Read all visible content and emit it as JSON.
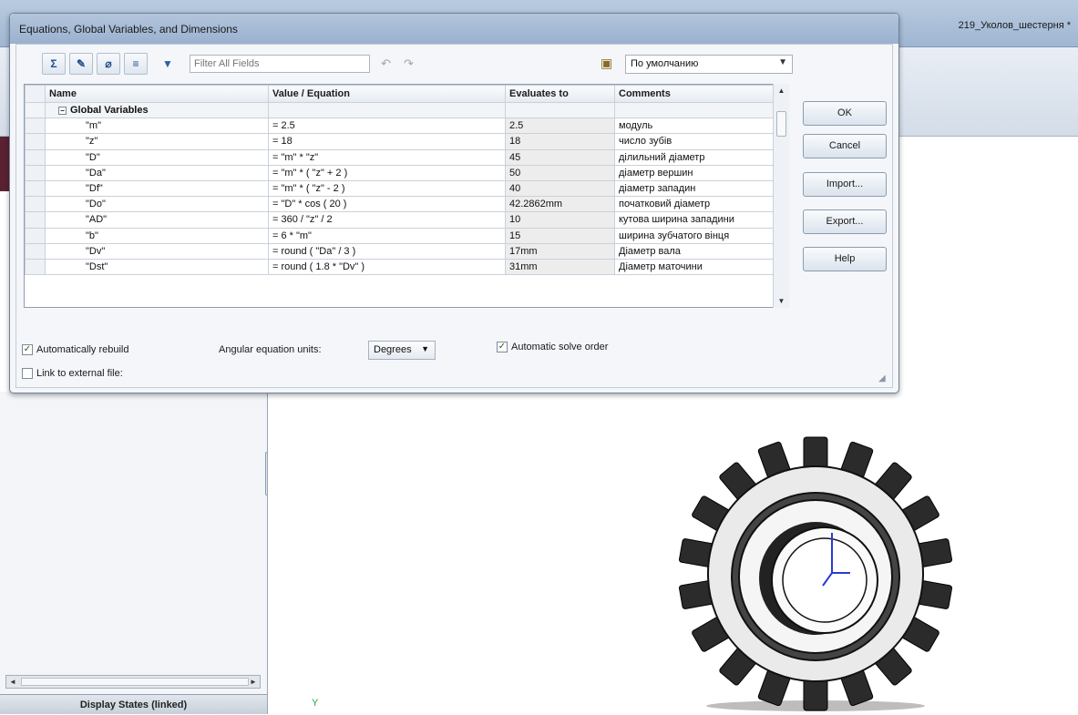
{
  "app": {
    "document_title": "219_Уколов_шестерня *",
    "display_states_label": "Display States (linked)",
    "axis_y_label": "Y"
  },
  "dialog": {
    "title": "Equations, Global Variables, and Dimensions",
    "filter_placeholder": "Filter All Fields",
    "configuration": "По умолчанию",
    "columns": [
      "Name",
      "Value / Equation",
      "Evaluates to",
      "Comments"
    ],
    "group_label": "Global Variables",
    "rows": [
      {
        "name": "\"m\"",
        "value": "= 2.5",
        "evaluates": "2.5",
        "comment": "модуль"
      },
      {
        "name": "\"z\"",
        "value": "= 18",
        "evaluates": "18",
        "comment": "число зубів"
      },
      {
        "name": "\"D\"",
        "value": "= \"m\" * \"z\"",
        "evaluates": "45",
        "comment": "ділильний діаметр"
      },
      {
        "name": "\"Da\"",
        "value": "= \"m\" * ( \"z\" + 2 )",
        "evaluates": "50",
        "comment": "діаметр вершин"
      },
      {
        "name": "\"Df\"",
        "value": "= \"m\" * ( \"z\" - 2 )",
        "evaluates": "40",
        "comment": "діаметр западин"
      },
      {
        "name": "\"Do\"",
        "value": "= \"D\" * cos ( 20 )",
        "evaluates": "42.2862mm",
        "comment": "початковий діаметр"
      },
      {
        "name": "\"AD\"",
        "value": "= 360 / \"z\" / 2",
        "evaluates": "10",
        "comment": "кутова ширина западини"
      },
      {
        "name": "\"b\"",
        "value": "= 6 * \"m\"",
        "evaluates": "15",
        "comment": "ширина зубчатого вінця"
      },
      {
        "name": "\"Dv\"",
        "value": "= round ( \"Da\" / 3 )",
        "evaluates": "17mm",
        "comment": "Діаметр вала"
      },
      {
        "name": "\"Dst\"",
        "value": "= round ( 1.8 * \"Dv\" )",
        "evaluates": "31mm",
        "comment": "Діаметр маточини"
      }
    ],
    "buttons": {
      "ok": "OK",
      "cancel": "Cancel",
      "import": "Import...",
      "export": "Export...",
      "help": "Help"
    },
    "auto_rebuild_label": "Automatically rebuild",
    "auto_rebuild_checked": true,
    "angular_units_label": "Angular equation units:",
    "angular_units_value": "Degrees",
    "auto_solve_label": "Automatic solve order",
    "auto_solve_checked": true,
    "link_external_label": "Link to external file:",
    "link_external_checked": false
  },
  "icons": {
    "check": "✓",
    "collapse": "−",
    "dropdown": "▼",
    "scroll_up": "▲",
    "scroll_down": "▼",
    "scroll_left": "◄",
    "scroll_right": "►"
  }
}
